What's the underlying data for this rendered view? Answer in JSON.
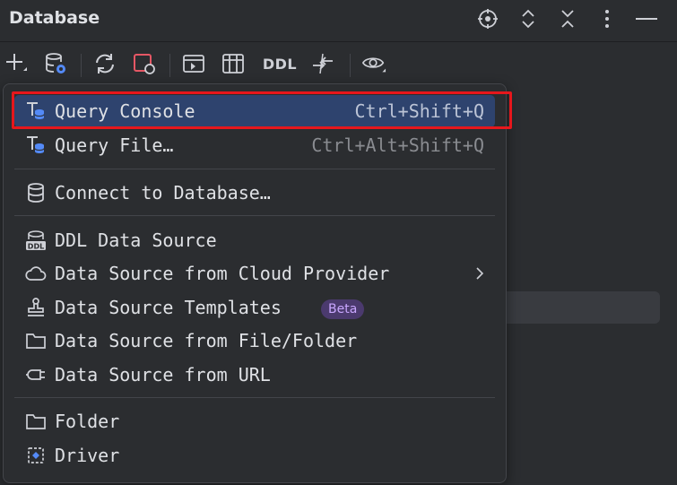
{
  "panel": {
    "title": "Database"
  },
  "toolbar": {
    "ddl_label": "DDL"
  },
  "menu": {
    "query_console": {
      "label": "Query Console",
      "shortcut": "Ctrl+Shift+Q"
    },
    "query_file": {
      "label": "Query File…",
      "shortcut": "Ctrl+Alt+Shift+Q"
    },
    "connect_to_database": {
      "label": "Connect to Database…"
    },
    "ddl_data_source": {
      "label": "DDL Data Source"
    },
    "data_source_cloud": {
      "label": "Data Source from Cloud Provider"
    },
    "data_source_templates": {
      "label": "Data Source Templates",
      "badge": "Beta"
    },
    "data_source_file": {
      "label": "Data Source from File/Folder"
    },
    "data_source_url": {
      "label": "Data Source from URL"
    },
    "folder": {
      "label": "Folder"
    },
    "driver": {
      "label": "Driver"
    }
  },
  "colors": {
    "selection": "#2e436e",
    "highlight_border": "#e6171c",
    "badge_bg": "#4b3a6e",
    "badge_text": "#c9a7ff",
    "accent_blue": "#548af7",
    "accent_red": "#e55765"
  }
}
